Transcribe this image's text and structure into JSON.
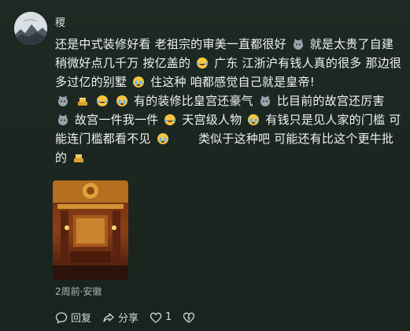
{
  "comment": {
    "username": "稷",
    "location_time": "2周前·安徽",
    "text_segments": [
      "还是中式装修好看 老祖宗的审美一直都很好",
      " 就是太贵了自建稍微好点几千万 按亿盖的",
      " 广东 江浙沪有钱人真的很多 那边很多过亿的别墅",
      " 住这种 咱都感觉自己就是皇帝!",
      " 有的装修比皇宫还豪气",
      " 比目前的故宫还厉害",
      " 故宫一件我一件",
      " 天宫级人物",
      " 有钱只是见人家的门槛 可能连门槛都看不见",
      "　　类似于这种吧 可能还有比这个更牛批的"
    ],
    "emoji_icons": [
      "cat-face-icon",
      "gold-bars-icon",
      "laughing-tears-icon",
      "crying-face-icon"
    ],
    "actions": {
      "reply_label": "回复",
      "share_label": "分享",
      "like_count": "1"
    }
  }
}
